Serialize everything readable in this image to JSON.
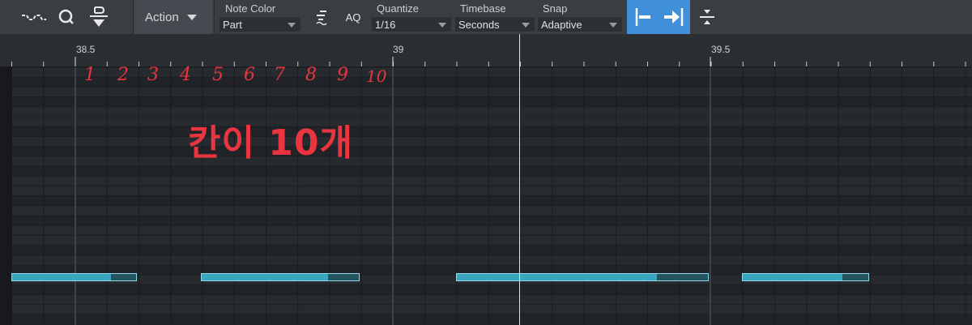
{
  "toolbar": {
    "action_label": "Action",
    "note_color": {
      "label": "Note Color",
      "value": "Part"
    },
    "aq_label": "AQ",
    "quantize": {
      "label": "Quantize",
      "value": "1/16"
    },
    "timebase": {
      "label": "Timebase",
      "value": "Seconds"
    },
    "snap": {
      "label": "Snap",
      "value": "Adaptive"
    },
    "icons": [
      "transform-wave-icon",
      "quantize-q-icon",
      "split-note-icon",
      "note-color-icon",
      "snap-left-icon",
      "snap-right-icon",
      "collapse-icon"
    ],
    "accent_color": "#3f8fd9"
  },
  "ruler": {
    "labels": [
      "38.5",
      "39",
      "39.5"
    ]
  },
  "annotation": {
    "numbers": [
      "1",
      "2",
      "3",
      "4",
      "5",
      "6",
      "7",
      "8",
      "9",
      "10"
    ],
    "korean_text": "칸이 10개",
    "color": "#e8353f"
  },
  "notes": {
    "color": "#3aa6bf",
    "tail_color": "#23545f",
    "count": 4
  }
}
